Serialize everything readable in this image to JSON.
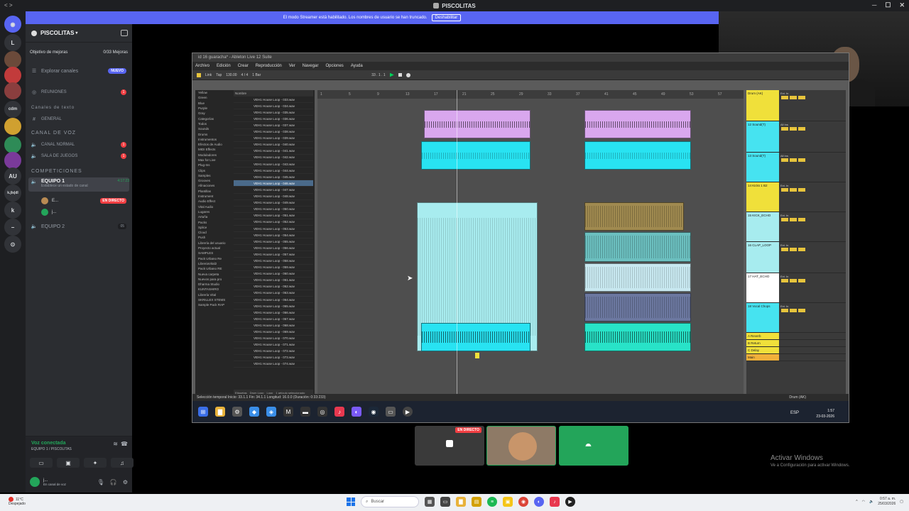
{
  "window": {
    "title": "PISCOLITAS",
    "left_label": "< >"
  },
  "server_rail": {
    "servers": [
      {
        "label": "L",
        "bg": "#313338"
      },
      {
        "label": "cdm",
        "bg": "#313338"
      },
      {
        "label": "AU",
        "bg": "#313338"
      },
      {
        "label": "k.jls|dl",
        "bg": "#313338"
      },
      {
        "label": "k",
        "bg": "#313338"
      }
    ]
  },
  "sidebar": {
    "server_name": "PISCOLITAS",
    "goal": {
      "label": "Objetivo de mejoras",
      "count": "0/33 Mejoras"
    },
    "explore": {
      "label": "Explorar canales",
      "badge": "NUEVO"
    },
    "reuniones": {
      "label": "REUNIONES",
      "badge": "1"
    },
    "text_category": "Canales de texto",
    "general": "GENERAL",
    "voice_category": "CANAL DE VOZ",
    "canal_normal": {
      "label": "CANAL NORMAL",
      "badge": "1"
    },
    "sala_juegos": {
      "label": "SALA DE JUEGOS",
      "badge": "1"
    },
    "comp_category": "COMPETICIONES",
    "equipo1": {
      "label": "EQUIPO 1",
      "time": "4:17:23",
      "status_hint": "Establece un estado de canal"
    },
    "members": [
      {
        "name": "E...",
        "live": "EN DIRECTO",
        "color": "#b98b53"
      },
      {
        "name": "j...",
        "live": "",
        "color": "#23a55a"
      }
    ],
    "equipo2": {
      "label": "EQUIPO 2",
      "count": "05"
    }
  },
  "voice_panel": {
    "title": "Voz conectada",
    "subtitle": "EQUIPO 1 / PISCOLITAS",
    "user_name": "j...",
    "user_status": "En canal de voz"
  },
  "banner": {
    "text": "El modo Streamer está habilitado. Los nombres de usuario se han truncado.",
    "button": "Deshabilitar"
  },
  "ableton": {
    "title": "id 16 guaracha* - Ableton Live 12 Suite",
    "menu": [
      "Archivo",
      "Edición",
      "Crear",
      "Reproducción",
      "Ver",
      "Navegar",
      "Opciones",
      "Ayuda"
    ],
    "transport": {
      "link": "Link",
      "tap": "Tap",
      "bpm": "130.00",
      "sig": "4 / 4",
      "position": "33 . 1 . 1",
      "bar": "1 Bar"
    },
    "places": [
      "Yellow",
      "Green",
      "Blue",
      "Purple",
      "Gray",
      "Categorías",
      "Todos",
      "Sounds",
      "Drums",
      "Instrumentos",
      "Efectos de Audio",
      "MIDI Effects",
      "Moduladores",
      "Max for Live",
      "Plug-Ins",
      "Clips",
      "Samples",
      "Grooves",
      "Afinaciones",
      "Plantillas",
      "Instrument",
      "Audio Effect",
      "Vital Audio",
      "Lugares",
      "Artuña",
      "Packs",
      "Splice",
      "Cloud",
      "Push",
      "Librería del usuario",
      "Proyecto actual",
      "SAMPLES",
      "Pack Urbano Re",
      "LibreriaVital2",
      "Pack Urbano RE",
      "Nueva carpeta",
      "Nuevos para pro",
      "Dharma Studio",
      "KUNTASHIRO",
      "Librería Vital",
      "SKRILLEX STEMS",
      "Sample Pack RAP"
    ],
    "files_header": "Nombre",
    "files": [
      "VEH1 House Loop - 033.wav",
      "VEH1 House Loop - 034.wav",
      "VEH1 House Loop - 035.wav",
      "VEH1 House Loop - 036.wav",
      "VEH1 House Loop - 037.wav",
      "VEH1 House Loop - 038.wav",
      "VEH1 House Loop - 039.wav",
      "VEH1 House Loop - 040.wav",
      "VEH1 House Loop - 041.wav",
      "VEH1 House Loop - 042.wav",
      "VEH1 House Loop - 043.wav",
      "VEH1 House Loop - 044.wav",
      "VEH1 House Loop - 045.wav",
      "VEH1 House Loop - 046.wav",
      "VEH1 House Loop - 047.wav",
      "VEH1 House Loop - 048.wav",
      "VEH1 House Loop - 049.wav",
      "VEH1 House Loop - 050.wav",
      "VEH1 House Loop - 051.wav",
      "VEH1 House Loop - 052.wav",
      "VEH1 House Loop - 053.wav",
      "VEH1 House Loop - 054.wav",
      "VEH1 House Loop - 055.wav",
      "VEH1 House Loop - 056.wav",
      "VEH1 House Loop - 057.wav",
      "VEH1 House Loop - 058.wav",
      "VEH1 House Loop - 059.wav",
      "VEH1 House Loop - 060.wav",
      "VEH1 House Loop - 061.wav",
      "VEH1 House Loop - 062.wav",
      "VEH1 House Loop - 063.wav",
      "VEH1 House Loop - 064.wav",
      "VEH1 House Loop - 065.wav",
      "VEH1 House Loop - 066.wav",
      "VEH1 House Loop - 067.wav",
      "VEH1 House Loop - 068.wav",
      "VEH1 House Loop - 069.wav",
      "VEH1 House Loop - 070.wav",
      "VEH1 House Loop - 071.wav",
      "VEH1 House Loop - 072.wav",
      "VEH1 House Loop - 073.wav",
      "VEH1 House Loop - 074.wav"
    ],
    "selected_file": 13,
    "browser_footer": {
      "tags": "Etiquetas",
      "tag1": "Drum Loop",
      "tag2": "Loop",
      "selected": "1 artículo seleccionado"
    },
    "ruler": [
      "1",
      "5",
      "9",
      "13",
      "17",
      "21",
      "25",
      "29",
      "33",
      "37",
      "41",
      "45",
      "49",
      "53",
      "57"
    ],
    "tracks": [
      {
        "name": "Drum (AK)",
        "color": "#f0e03a",
        "vol": "Ext. In"
      },
      {
        "name": "12 Sound(T)",
        "color": "#46e3f0",
        "vol": "All Ins"
      },
      {
        "name": "13 Sound(T)",
        "color": "#46e3f0",
        "vol": "All Ins"
      },
      {
        "name": "14 Kicks 1 B2",
        "color": "#f0e03a",
        "vol": "Ext. In"
      },
      {
        "name": "15 KICK_ECHO",
        "color": "#a7ecef",
        "vol": "Ext. In"
      },
      {
        "name": "16 CLAP_LOOP",
        "color": "#a7ecef",
        "vol": "Ext. In"
      },
      {
        "name": "17 HAT_ECHO",
        "color": "#ffffff",
        "vol": "Ext. In"
      },
      {
        "name": "18 Vocal Chops",
        "color": "#46e3f0",
        "vol": "Ext. In"
      }
    ],
    "returns": [
      "A Reverb",
      "B Return",
      "C Delay",
      "Main"
    ],
    "status": "Selección temporal   Inicio: 33.1.1   Fin: 34.1.1   Longitud: 16.0.0 (Duración: 0:33:233)",
    "footer_right": "Drum (AK)",
    "lang": "ESP",
    "time": "1:57",
    "date": "23-03-2026"
  },
  "tiles": [
    {
      "label": "EN DIRECTO",
      "bg": "#3a3a3a"
    },
    {
      "label": "",
      "bg": "#8e7a66"
    },
    {
      "label": "",
      "bg": "#23a55a"
    }
  ],
  "watermark": {
    "line1": "Activar Windows",
    "line2": "Ve a Configuración para activar Windows."
  },
  "taskbar": {
    "weather_temp": "11°C",
    "weather_desc": "Despejado",
    "search_placeholder": "Buscar",
    "time": "0:57 a. m.",
    "date": "25/03/2026"
  }
}
